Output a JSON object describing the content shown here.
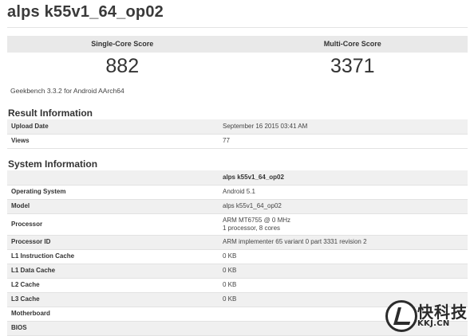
{
  "header": {
    "title": "alps k55v1_64_op02"
  },
  "scores": {
    "single_label": "Single-Core Score",
    "single_value": "882",
    "multi_label": "Multi-Core Score",
    "multi_value": "3371"
  },
  "version": "Geekbench 3.3.2 for Android AArch64",
  "result_info": {
    "title": "Result Information",
    "rows": [
      {
        "label": "Upload Date",
        "value": "September 16 2015 03:41 AM"
      },
      {
        "label": "Views",
        "value": "77"
      }
    ]
  },
  "system_info": {
    "title": "System Information",
    "column_header": "alps k55v1_64_op02",
    "rows": [
      {
        "label": "Operating System",
        "value": "Android 5.1"
      },
      {
        "label": "Model",
        "value": "alps k55v1_64_op02"
      },
      {
        "label": "Processor",
        "value_line1": "ARM MT6755 @ 0 MHz",
        "value_line2": "1 processor, 8 cores"
      },
      {
        "label": "Processor ID",
        "value": "ARM implementer 65 variant 0 part 3331 revision 2"
      },
      {
        "label": "L1 Instruction Cache",
        "value": "0 KB"
      },
      {
        "label": "L1 Data Cache",
        "value": "0 KB"
      },
      {
        "label": "L2 Cache",
        "value": "0 KB"
      },
      {
        "label": "L3 Cache",
        "value": "0 KB"
      },
      {
        "label": "Motherboard",
        "value": ""
      },
      {
        "label": "BIOS",
        "value": ""
      }
    ]
  },
  "watermark": {
    "text": "快科技",
    "sub": "KKJ.CN"
  }
}
